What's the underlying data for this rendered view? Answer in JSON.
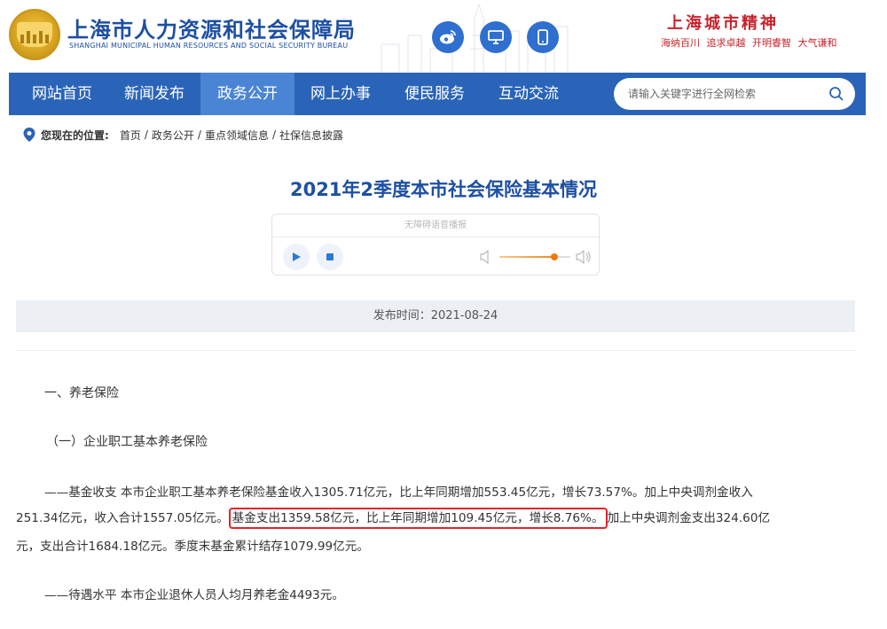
{
  "header": {
    "site_name_cn": "上海市人力资源和社会保障局",
    "site_name_en": "SHANGHAI MUNICIPAL HUMAN RESOURCES AND SOCIAL SECURITY BUREAU",
    "slogan_title": "上海城市精神",
    "slogan_sub": "海纳百川 追求卓越 开明睿智 大气谦和",
    "icons": [
      "weibo-icon",
      "monitor-icon",
      "mobile-icon"
    ],
    "brand_color": "#1d4fa3",
    "slogan_color": "#c8232c"
  },
  "nav": {
    "items": [
      {
        "label": "网站首页",
        "active": false
      },
      {
        "label": "新闻发布",
        "active": false
      },
      {
        "label": "政务公开",
        "active": true
      },
      {
        "label": "网上办事",
        "active": false
      },
      {
        "label": "便民服务",
        "active": false
      },
      {
        "label": "互动交流",
        "active": false
      }
    ],
    "search_placeholder": "请输入关键字进行全网检索",
    "bar_color": "#2a64b8",
    "active_color": "#4a84d4"
  },
  "breadcrumb": {
    "label": "您现在的位置:",
    "items": [
      "首页",
      "政务公开",
      "重点领域信息",
      "社保信息披露"
    ]
  },
  "article": {
    "title": "2021年2季度本市社会保险基本情况",
    "player_label": "无障碍语音播报",
    "volume_level": 0.78,
    "publish_time": "发布时间：2021-08-24",
    "section1": "一、养老保险",
    "subsection1": "（一）企业职工基本养老保险",
    "p1_line1": "——基金收支 本市企业职工基本养老保险基金收入1305.71亿元，比上年同期增加553.45亿元，增长73.57%。加上中央调剂金收入",
    "p1_line2_before": "251.34亿元，收入合计1557.05亿元。",
    "p1_line2_highlight": "基金支出1359.58亿元，比上年同期增加109.45亿元，增长8.76%。",
    "p1_line2_after": "加上中央调剂金支出324.60亿",
    "p1_line3": "元，支出合计1684.18亿元。季度末基金累计结存1079.99亿元。",
    "p2": "——待遇水平 本市企业退休人员人均月养老金4493元。",
    "highlight_color": "#e0242b"
  }
}
